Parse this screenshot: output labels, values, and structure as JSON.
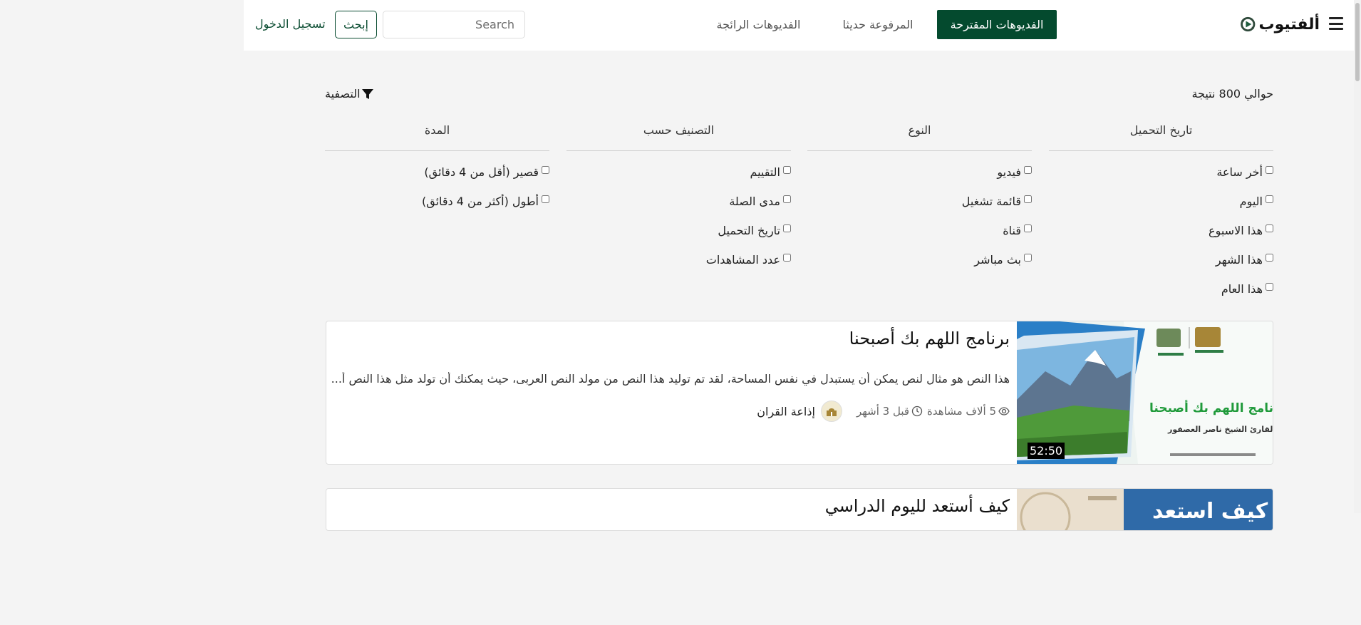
{
  "nav": {
    "brand": "ألفتيوب",
    "tabs": [
      {
        "label": "الفديوهات المقترحة",
        "active": true
      },
      {
        "label": "المرفوعة حديثا",
        "active": false
      },
      {
        "label": "الفديوهات الرائجة",
        "active": false
      }
    ],
    "search_placeholder": "Search",
    "search_button": "إبحث",
    "login": "تسجيل الدخول"
  },
  "results": {
    "count_text": "حوالي 800 نتيجة",
    "filter_toggle": "التصفية"
  },
  "filters": [
    {
      "heading": "تاريخ التحميل",
      "options": [
        "أخر ساعة",
        "اليوم",
        "هذا الاسبوع",
        "هذا الشهر",
        "هذا العام"
      ]
    },
    {
      "heading": "النوع",
      "options": [
        "فيديو",
        "قائمة تشغيل",
        "قناة",
        "بث مباشر"
      ]
    },
    {
      "heading": "التصنيف حسب",
      "options": [
        "التقييم",
        "مدى الصلة",
        "تاريخ التحميل",
        "عدد المشاهدات"
      ]
    },
    {
      "heading": "المدة",
      "options": [
        "قصير (أقل من 4 دقائق)",
        "أطول (أكثر من 4 دقائق)"
      ]
    }
  ],
  "videos": [
    {
      "title": "برنامج اللهم بك أصبحنا",
      "description": "هذا النص هو مثال لنص يمكن أن يستبدل في نفس المساحة، لقد تم توليد هذا النص من مولد النص العربى، حيث يمكنك أن تولد مثل هذا النص أ...",
      "views": "5 ألاف مشاهدة",
      "age": "قبل 3 أشهر",
      "channel": "إذاعة القران",
      "duration": "52:50",
      "thumb": {
        "title": "برنامج اللهم بك أصبحنا",
        "reciter": "القارئ الشيخ ناصر العصفور"
      }
    },
    {
      "title": "كيف أستعد لليوم الدراسي",
      "thumb": {
        "title": "كيف استعد"
      }
    }
  ],
  "colors": {
    "primary": "#044a2e",
    "link": "#0b4d32",
    "background": "#f4f4f4"
  }
}
